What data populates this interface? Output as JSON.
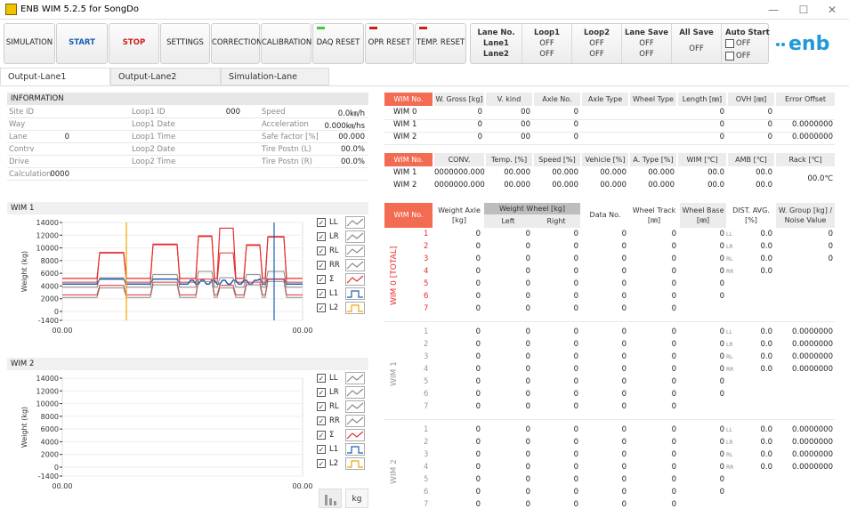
{
  "window": {
    "title": "ENB WIM 5.2.5 for SongDo",
    "min": "—",
    "max": "☐",
    "close": "✕"
  },
  "toolbar": {
    "buttons": [
      {
        "label": "SIMULATION",
        "color": "#222",
        "led": ""
      },
      {
        "label": "START",
        "color": "#1a5fb4",
        "led": ""
      },
      {
        "label": "STOP",
        "color": "#d01c1c",
        "led": ""
      },
      {
        "label": "SETTINGS",
        "color": "#222",
        "led": ""
      },
      {
        "label": "CORRECTION",
        "color": "#222",
        "led": ""
      },
      {
        "label": "CALIBRATION",
        "color": "#222",
        "led": ""
      },
      {
        "label": "DAQ RESET",
        "color": "#222",
        "led": "#3ec93e"
      },
      {
        "label": "OPR RESET",
        "color": "#222",
        "led": "#d01c1c"
      },
      {
        "label": "TEMP. RESET",
        "color": "#222",
        "led": "#d01c1c"
      }
    ],
    "status": {
      "lane": {
        "h": "Lane No.",
        "v1": "Lane1",
        "v2": "Lane2"
      },
      "loop1": {
        "h": "Loop1",
        "v1": "OFF",
        "v2": "OFF"
      },
      "loop2": {
        "h": "Loop2",
        "v1": "OFF",
        "v2": "OFF"
      },
      "lanesave": {
        "h": "Lane Save",
        "v1": "OFF",
        "v2": "OFF"
      },
      "allsave": {
        "h": "All Save",
        "v1": "OFF"
      },
      "autostart": {
        "h": "Auto Start",
        "v1": "OFF",
        "v2": "OFF"
      }
    },
    "logo": "enb"
  },
  "tabs": [
    "Output-Lane1",
    "Output-Lane2",
    "Simulation-Lane"
  ],
  "info": {
    "header": "INFORMATION",
    "col1": [
      {
        "k": "Site ID",
        "v": ""
      },
      {
        "k": "Way",
        "v": ""
      },
      {
        "k": "Lane",
        "v": "0"
      },
      {
        "k": "Contrv",
        "v": ""
      },
      {
        "k": "Drive",
        "v": ""
      },
      {
        "k": "Calculation",
        "v": "0000"
      }
    ],
    "col2": [
      {
        "k": "Loop1 ID",
        "v": "000"
      },
      {
        "k": "Loop1 Date",
        "v": ""
      },
      {
        "k": "Loop1 Time",
        "v": ""
      },
      {
        "k": "Loop2 Date",
        "v": ""
      },
      {
        "k": "Loop2 Time",
        "v": ""
      }
    ],
    "col3": [
      {
        "k": "Speed",
        "v": "0.0㎞/h"
      },
      {
        "k": "Acceleration",
        "v": "0.000㎞/hs"
      },
      {
        "k": "Safe factor [%]",
        "v": "00.000"
      },
      {
        "k": "Tire Postn (L)",
        "v": "00.0%"
      },
      {
        "k": "Tire Postn (R)",
        "v": "00.0%"
      }
    ]
  },
  "wim1": {
    "header": "WIM 1",
    "yticks": [
      "14000",
      "12000",
      "10000",
      "8000",
      "6000",
      "4000",
      "2000",
      "0",
      "-1400"
    ],
    "ylabel": "Weight (kg)",
    "x0": "00.00",
    "x1": "00.00",
    "legend": [
      {
        "k": "LL",
        "c": "#888"
      },
      {
        "k": "LR",
        "c": "#888"
      },
      {
        "k": "RL",
        "c": "#888"
      },
      {
        "k": "RR",
        "c": "#888"
      },
      {
        "k": "Σ",
        "c": "#e62c2c"
      },
      {
        "k": "L1",
        "c": "#1a5fb4"
      },
      {
        "k": "L2",
        "c": "#f2a500"
      }
    ]
  },
  "wim2": {
    "header": "WIM 2",
    "yticks": [
      "14000",
      "12000",
      "10000",
      "8000",
      "6000",
      "4000",
      "2000",
      "0",
      "-1400"
    ],
    "ylabel": "Weight (kg)",
    "x0": "00.00",
    "x1": "00.00",
    "legend": [
      {
        "k": "LL",
        "c": "#888"
      },
      {
        "k": "LR",
        "c": "#888"
      },
      {
        "k": "RL",
        "c": "#888"
      },
      {
        "k": "RR",
        "c": "#888"
      },
      {
        "k": "Σ",
        "c": "#e62c2c"
      },
      {
        "k": "L1",
        "c": "#1a5fb4"
      },
      {
        "k": "L2",
        "c": "#f2a500"
      }
    ],
    "btn_kg": "kg"
  },
  "table1": {
    "headers": [
      "WIM No.",
      "W. Gross [kg]",
      "V. kind",
      "Axle No.",
      "Axle Type",
      "Wheel Type",
      "Length [㎜]",
      "OVH [㎜]",
      "Error Offset"
    ],
    "rows": [
      [
        "WIM 0",
        "0",
        "00",
        "0",
        "",
        "",
        "0",
        "0",
        ""
      ],
      [
        "WIM 1",
        "0",
        "00",
        "0",
        "",
        "",
        "0",
        "0",
        "0.0000000"
      ],
      [
        "WIM 2",
        "0",
        "00",
        "0",
        "",
        "",
        "0",
        "0",
        "0.0000000"
      ]
    ]
  },
  "table2": {
    "headers": [
      "WIM No.",
      "CONV.",
      "Temp. [%]",
      "Speed [%]",
      "Vehicle [%]",
      "A. Type [%]",
      "WIM [℃]",
      "AMB [℃]",
      "Rack [℃]"
    ],
    "rows": [
      [
        "WIM 1",
        "0000000.000",
        "00.000",
        "00.000",
        "00.000",
        "00.000",
        "00.0",
        "00.0"
      ],
      [
        "WIM 2",
        "0000000.000",
        "00.000",
        "00.000",
        "00.000",
        "00.000",
        "00.0",
        "00.0"
      ]
    ],
    "rack": "00.0℃"
  },
  "table3": {
    "headers": [
      "WIM No.",
      "Weight Axle [kg]",
      "Weight Wheel [kg]",
      "Left",
      "Right",
      "Data No.",
      "Wheel Track [㎜]",
      "Wheel Base [㎜]",
      "DIST. AVG. [%]",
      "W. Group [kg] / Noise Value"
    ],
    "groups": [
      {
        "name": "WIM 0 [TOTAL]",
        "red": true,
        "rows": [
          [
            "1",
            "0",
            "0",
            "0",
            "0",
            "0",
            "0",
            "LL",
            "0.0",
            "0"
          ],
          [
            "2",
            "0",
            "0",
            "0",
            "0",
            "0",
            "0",
            "LR",
            "0.0",
            "0"
          ],
          [
            "3",
            "0",
            "0",
            "0",
            "0",
            "0",
            "0",
            "RL",
            "0.0",
            "0"
          ],
          [
            "4",
            "0",
            "0",
            "0",
            "0",
            "0",
            "0",
            "RR",
            "0.0",
            ""
          ],
          [
            "5",
            "0",
            "0",
            "0",
            "0",
            "0",
            "0",
            "",
            "",
            ""
          ],
          [
            "6",
            "0",
            "0",
            "0",
            "0",
            "0",
            "0",
            "",
            "",
            ""
          ],
          [
            "7",
            "0",
            "0",
            "0",
            "0",
            "0",
            "",
            "",
            "",
            ""
          ]
        ]
      },
      {
        "name": "WIM 1",
        "red": false,
        "rows": [
          [
            "1",
            "0",
            "0",
            "0",
            "0",
            "0",
            "0",
            "LL",
            "0.0",
            "0.0000000"
          ],
          [
            "2",
            "0",
            "0",
            "0",
            "0",
            "0",
            "0",
            "LR",
            "0.0",
            "0.0000000"
          ],
          [
            "3",
            "0",
            "0",
            "0",
            "0",
            "0",
            "0",
            "RL",
            "0.0",
            "0.0000000"
          ],
          [
            "4",
            "0",
            "0",
            "0",
            "0",
            "0",
            "0",
            "RR",
            "0.0",
            "0.0000000"
          ],
          [
            "5",
            "0",
            "0",
            "0",
            "0",
            "0",
            "0",
            "",
            "",
            ""
          ],
          [
            "6",
            "0",
            "0",
            "0",
            "0",
            "0",
            "0",
            "",
            "",
            ""
          ],
          [
            "7",
            "0",
            "0",
            "0",
            "0",
            "0",
            "",
            "",
            "",
            ""
          ]
        ]
      },
      {
        "name": "WIM 2",
        "red": false,
        "rows": [
          [
            "1",
            "0",
            "0",
            "0",
            "0",
            "0",
            "0",
            "LL",
            "0.0",
            "0.0000000"
          ],
          [
            "2",
            "0",
            "0",
            "0",
            "0",
            "0",
            "0",
            "LR",
            "0.0",
            "0.0000000"
          ],
          [
            "3",
            "0",
            "0",
            "0",
            "0",
            "0",
            "0",
            "RL",
            "0.0",
            "0.0000000"
          ],
          [
            "4",
            "0",
            "0",
            "0",
            "0",
            "0",
            "0",
            "RR",
            "0.0",
            "0.0000000"
          ],
          [
            "5",
            "0",
            "0",
            "0",
            "0",
            "0",
            "0",
            "",
            "",
            ""
          ],
          [
            "6",
            "0",
            "0",
            "0",
            "0",
            "0",
            "0",
            "",
            "",
            ""
          ],
          [
            "7",
            "0",
            "0",
            "0",
            "0",
            "0",
            "",
            "",
            "",
            ""
          ]
        ]
      }
    ]
  }
}
